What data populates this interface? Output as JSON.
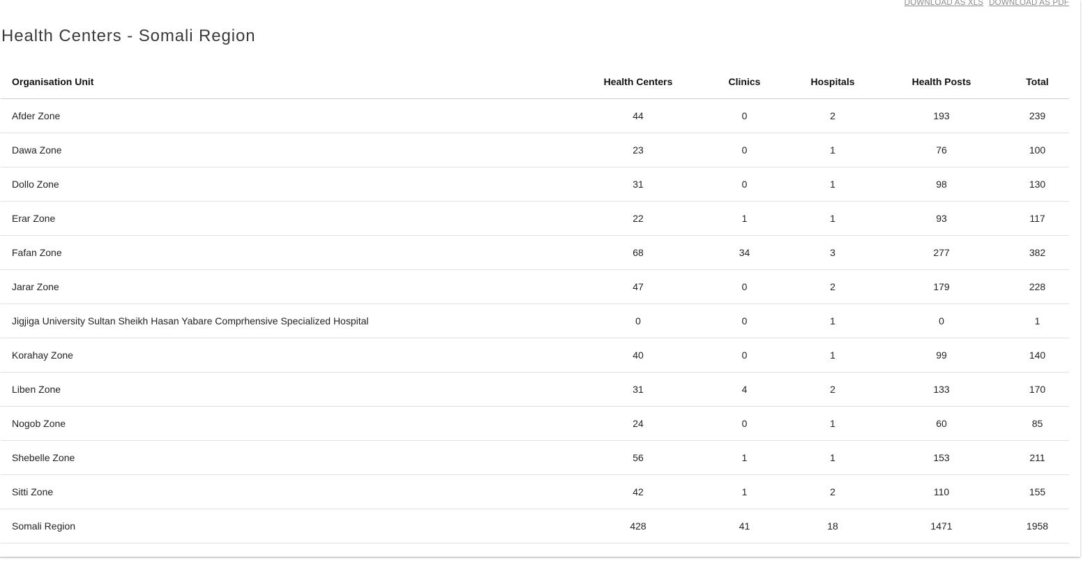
{
  "downloads": {
    "xls_label": "DOWNLOAD AS XLS",
    "pdf_label": "DOWNLOAD AS PDF"
  },
  "title": "Health Centers - Somali Region",
  "table": {
    "headers": [
      "Organisation Unit",
      "Health Centers",
      "Clinics",
      "Hospitals",
      "Health Posts",
      "Total"
    ],
    "rows": [
      [
        "Afder Zone",
        "44",
        "0",
        "2",
        "193",
        "239"
      ],
      [
        "Dawa Zone",
        "23",
        "0",
        "1",
        "76",
        "100"
      ],
      [
        "Dollo Zone",
        "31",
        "0",
        "1",
        "98",
        "130"
      ],
      [
        "Erar Zone",
        "22",
        "1",
        "1",
        "93",
        "117"
      ],
      [
        "Fafan Zone",
        "68",
        "34",
        "3",
        "277",
        "382"
      ],
      [
        "Jarar Zone",
        "47",
        "0",
        "2",
        "179",
        "228"
      ],
      [
        "Jigjiga University Sultan Sheikh Hasan Yabare Comprhensive Specialized Hospital",
        "0",
        "0",
        "1",
        "0",
        "1"
      ],
      [
        "Korahay Zone",
        "40",
        "0",
        "1",
        "99",
        "140"
      ],
      [
        "Liben Zone",
        "31",
        "4",
        "2",
        "133",
        "170"
      ],
      [
        "Nogob Zone",
        "24",
        "0",
        "1",
        "60",
        "85"
      ],
      [
        "Shebelle Zone",
        "56",
        "1",
        "1",
        "153",
        "211"
      ],
      [
        "Sitti Zone",
        "42",
        "1",
        "2",
        "110",
        "155"
      ],
      [
        "Somali Region",
        "428",
        "41",
        "18",
        "1471",
        "1958"
      ]
    ]
  }
}
